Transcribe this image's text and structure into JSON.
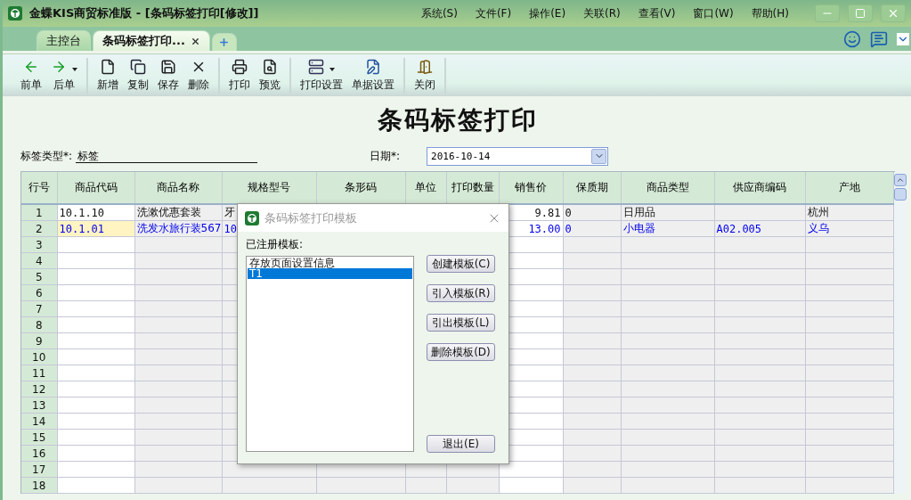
{
  "window": {
    "title": "金蝶KIS商贸标准版 - [条码标签打印[修改]]"
  },
  "menu": [
    "系统(S)",
    "文件(F)",
    "操作(E)",
    "关联(R)",
    "查看(V)",
    "窗口(W)",
    "帮助(H)"
  ],
  "tabs": [
    {
      "label": "主控台",
      "selected": false,
      "closable": false
    },
    {
      "label": "条码标签打印...",
      "selected": true,
      "closable": true
    }
  ],
  "toolbar": [
    [
      {
        "label": "前单",
        "dropdown": false
      },
      {
        "label": "后单",
        "dropdown": true
      }
    ],
    [
      {
        "label": "新增",
        "dropdown": false
      },
      {
        "label": "复制",
        "dropdown": false
      },
      {
        "label": "保存",
        "dropdown": false
      },
      {
        "label": "删除",
        "dropdown": false
      }
    ],
    [
      {
        "label": "打印",
        "dropdown": false
      },
      {
        "label": "预览",
        "dropdown": false
      }
    ],
    [
      {
        "label": "打印设置",
        "dropdown": true
      },
      {
        "label": "单据设置",
        "dropdown": false
      }
    ],
    [
      {
        "label": "关闭",
        "dropdown": false
      }
    ]
  ],
  "form": {
    "title": "条码标签打印",
    "label_type": {
      "label": "标签类型*:",
      "value": "标签"
    },
    "date": {
      "label": "日期*:",
      "value": "2016-10-14"
    }
  },
  "table": {
    "columns": [
      "行号",
      "商品代码",
      "商品名称",
      "规格型号",
      "条形码",
      "单位",
      "打印数量",
      "销售价",
      "保质期",
      "商品类型",
      "供应商编码",
      "产地"
    ],
    "rows": [
      {
        "selected": false,
        "cells": [
          "1",
          "10.1.10",
          "洗漱优惠套装",
          "牙",
          "",
          "",
          "",
          "9.81",
          "0",
          "日用品",
          "",
          "杭州"
        ]
      },
      {
        "selected": true,
        "cells": [
          "2",
          "10.1.01",
          "洗发水旅行装567",
          "10",
          "",
          "",
          "",
          "13.00",
          "0",
          "小电器",
          "A02.005",
          "义乌"
        ]
      },
      {
        "selected": false,
        "cells": [
          "3"
        ]
      },
      {
        "selected": false,
        "cells": [
          "4"
        ]
      },
      {
        "selected": false,
        "cells": [
          "5"
        ]
      },
      {
        "selected": false,
        "cells": [
          "6"
        ]
      },
      {
        "selected": false,
        "cells": [
          "7"
        ]
      },
      {
        "selected": false,
        "cells": [
          "8"
        ]
      },
      {
        "selected": false,
        "cells": [
          "9"
        ]
      },
      {
        "selected": false,
        "cells": [
          "10"
        ]
      },
      {
        "selected": false,
        "cells": [
          "11"
        ]
      },
      {
        "selected": false,
        "cells": [
          "12"
        ]
      },
      {
        "selected": false,
        "cells": [
          "13"
        ]
      },
      {
        "selected": false,
        "cells": [
          "14"
        ]
      },
      {
        "selected": false,
        "cells": [
          "15"
        ]
      },
      {
        "selected": false,
        "cells": [
          "16"
        ]
      },
      {
        "selected": false,
        "cells": [
          "17"
        ]
      },
      {
        "selected": false,
        "cells": [
          "18"
        ]
      }
    ]
  },
  "dialog": {
    "title": "条码标签打印模板",
    "list_label": "已注册模板:",
    "templates": [
      {
        "label": "存放页面设置信息",
        "selected": false
      },
      {
        "label": "T1",
        "selected": true
      }
    ],
    "buttons": [
      "创建模板(C)",
      "引入模板(R)",
      "引出模板(L)",
      "删除模板(D)"
    ],
    "exit_button": "退出(E)"
  }
}
